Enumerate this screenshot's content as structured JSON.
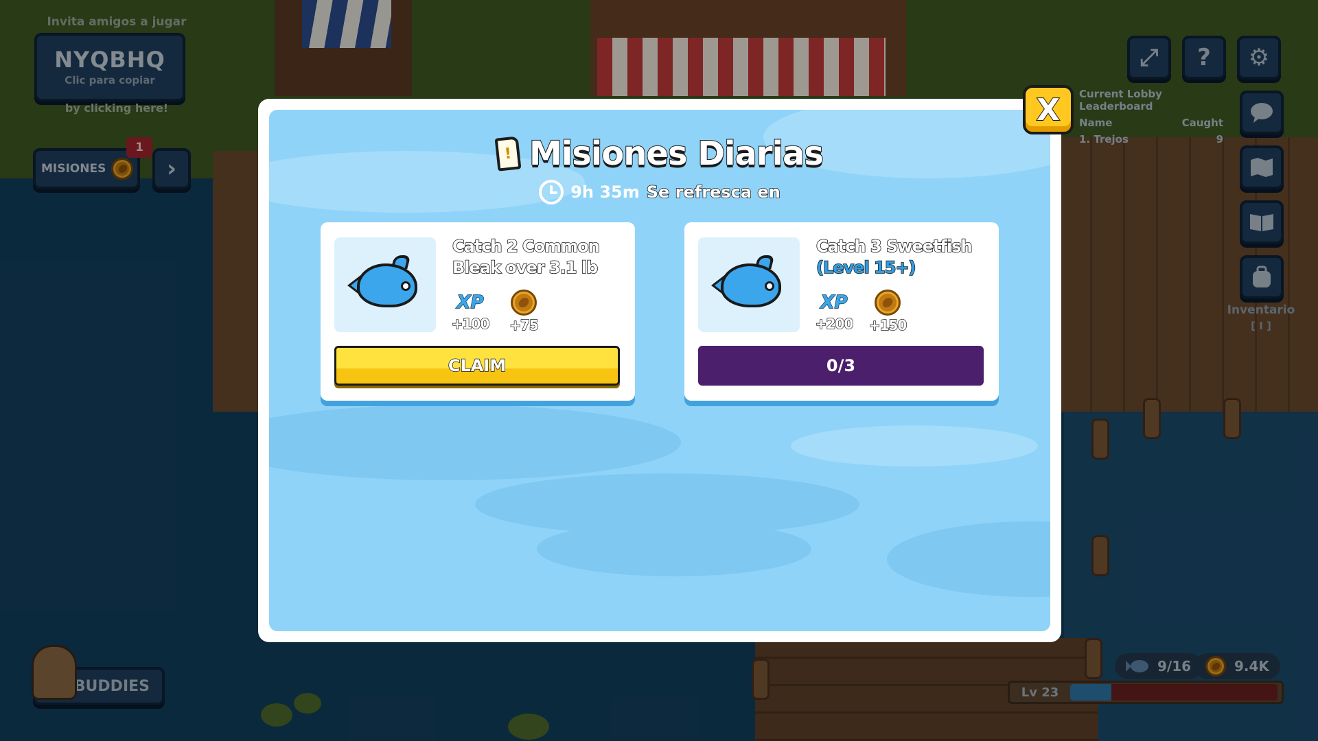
{
  "invite": {
    "top_text": "Invita amigos a jugar",
    "code": "NYQBHQ",
    "copy_hint": "Clic para copiar",
    "bottom_text": "by clicking here!"
  },
  "missions_button": {
    "label": "MISIONES",
    "badge_count": "1",
    "arrow": "›"
  },
  "top_right": {
    "fullscreen_icon": "⤢",
    "help_icon": "?",
    "settings_icon": "⚙"
  },
  "leaderboard": {
    "title": "Current Lobby Leaderboard",
    "col_name": "Name",
    "col_caught": "Caught",
    "rows": [
      {
        "name": "1. Trejos",
        "caught": "9"
      }
    ]
  },
  "inventory": {
    "label": "Inventario",
    "key": "[ I ]"
  },
  "buddies": {
    "label": "BUDDIES"
  },
  "stats": {
    "fish_count": "9/16",
    "coins": "9.4K",
    "level_label": "Lv 23",
    "level_progress": 0.2
  },
  "modal": {
    "title": "Misiones Diarias",
    "refresh_time": "9h 35m",
    "refresh_label": "Se refresca en",
    "close_label": "X",
    "missions": [
      {
        "title_line1": "Catch 2 Common",
        "title_line2": "Bleak over 3.1 lb",
        "xp_label": "XP",
        "xp_reward": "+100",
        "coin_reward": "+75",
        "action_label": "CLAIM"
      },
      {
        "title_line1": "Catch 3 Sweetfish",
        "title_line2": "(Level 15+)",
        "xp_label": "XP",
        "xp_reward": "+200",
        "coin_reward": "+150",
        "progress_label": "0/3"
      }
    ]
  },
  "colors": {
    "modal_bg": "#8fd3f8",
    "claim_yellow": "#ffe23d",
    "progress_purple": "#4b1f6b",
    "fish_blue": "#3ba6ec",
    "level_requirement_blue": "#2f9ee6"
  },
  "icons": {
    "quest": "scroll-icon",
    "timer": "clock-icon",
    "fish": "fish-icon",
    "xp": "xp-icon",
    "coin": "coin-icon"
  }
}
